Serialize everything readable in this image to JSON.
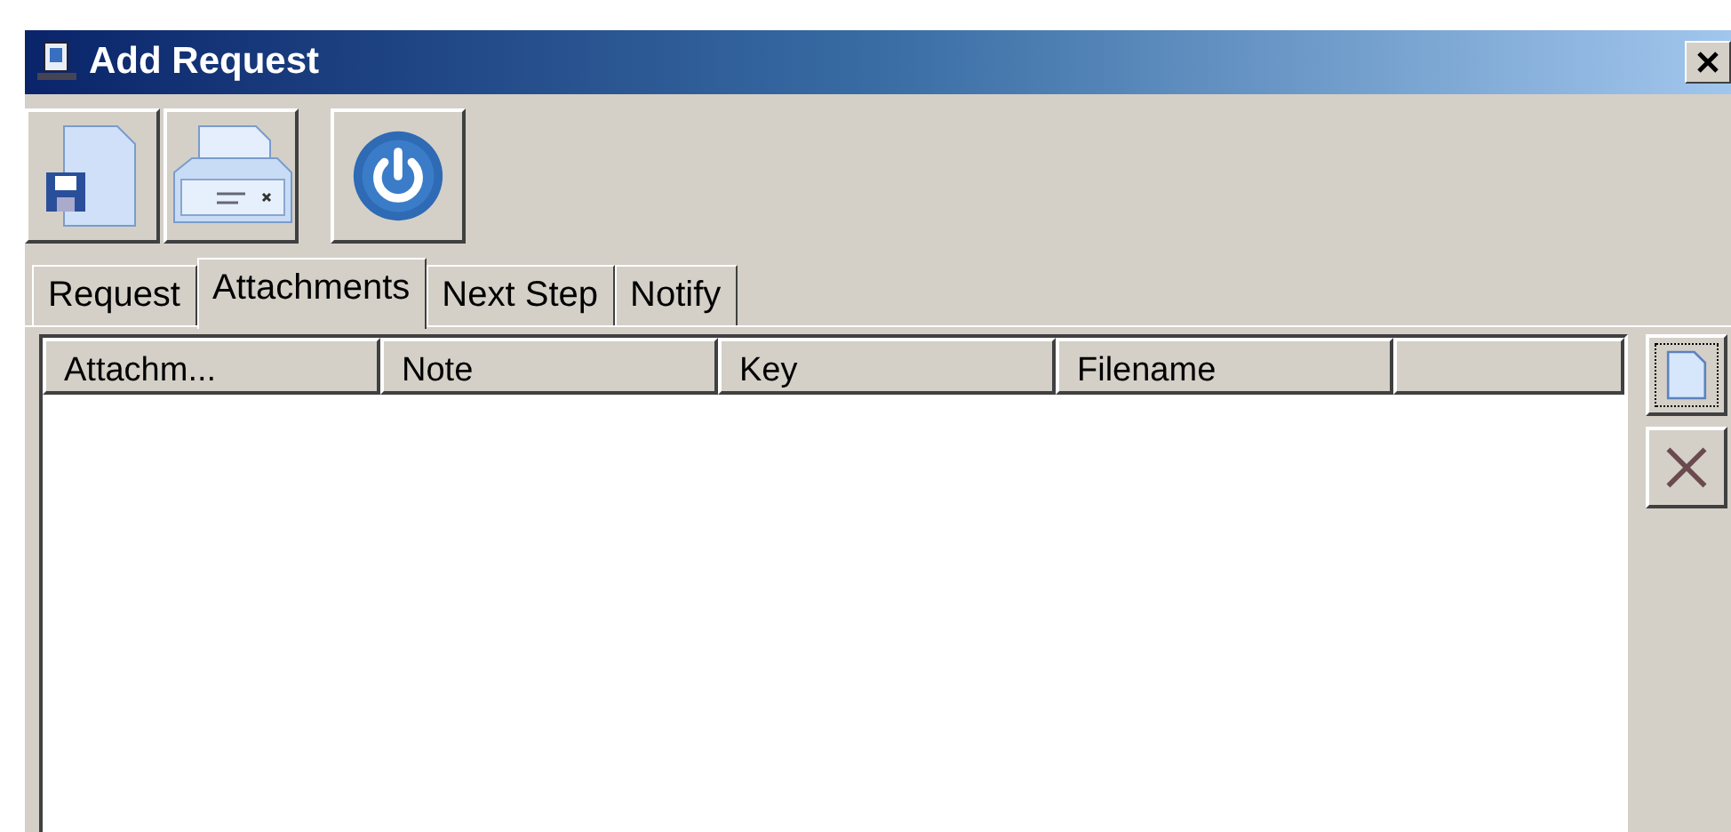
{
  "window": {
    "title": "Add Request"
  },
  "tabs": [
    {
      "label": "Request",
      "selected": false
    },
    {
      "label": "Attachments",
      "selected": true
    },
    {
      "label": "Next Step",
      "selected": false
    },
    {
      "label": "Notify",
      "selected": false
    }
  ],
  "table": {
    "columns": [
      "Attachm...",
      "Note",
      "Key",
      "Filename"
    ]
  }
}
